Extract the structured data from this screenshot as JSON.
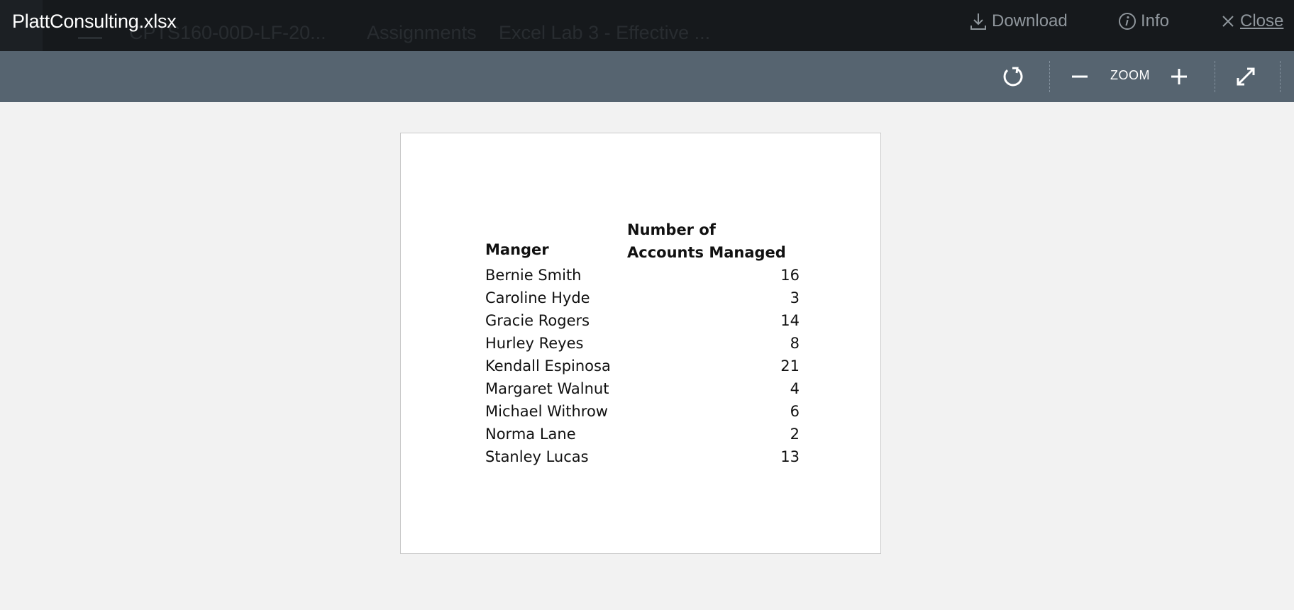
{
  "window": {
    "file_title": "PlattConsulting.xlsx"
  },
  "background_nav": {
    "course": "CPTS160-00D-LF-20...",
    "assignments": "Assignments",
    "current": "Excel Lab 3 - Effective ..."
  },
  "top_actions": {
    "download_label": "Download",
    "info_label": "Info",
    "close_label": "Close"
  },
  "toolbar": {
    "zoom_label": "ZOOM",
    "icons": [
      "rotate-icon",
      "zoom-out-icon",
      "zoom-in-icon",
      "fullscreen-icon"
    ]
  },
  "sheet": {
    "header_manager": "Manger",
    "header_accounts": "Number of Accounts Managed",
    "rows": [
      {
        "name": "Bernie Smith",
        "count": "16"
      },
      {
        "name": "Caroline Hyde",
        "count": "3"
      },
      {
        "name": "Gracie Rogers",
        "count": "14"
      },
      {
        "name": "Hurley Reyes",
        "count": "8"
      },
      {
        "name": "Kendall Espinosa",
        "count": "21"
      },
      {
        "name": "Margaret Walnut",
        "count": "4"
      },
      {
        "name": "Michael Withrow",
        "count": "6"
      },
      {
        "name": "Norma Lane",
        "count": "2"
      },
      {
        "name": "Stanley Lucas",
        "count": "13"
      }
    ]
  },
  "colors": {
    "topbar_bg": "#16191c",
    "toolbar_bg": "#566470",
    "viewer_bg": "#f2f2f2",
    "action_text": "#8f969c"
  }
}
